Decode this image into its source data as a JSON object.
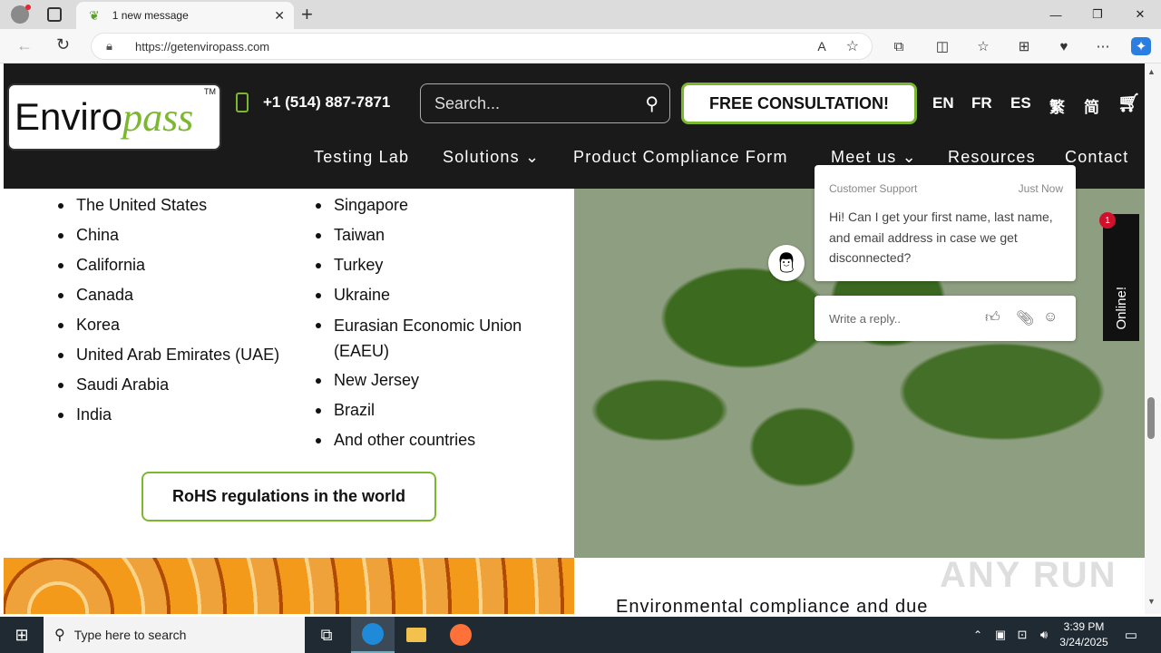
{
  "browser": {
    "tab_title": "1 new message",
    "tab_close": "✕",
    "new_tab": "+",
    "url": "https://getenviropass.com",
    "win_min": "—",
    "win_restore": "❐",
    "win_close": "✕"
  },
  "site": {
    "logo_part1": "Enviro",
    "logo_part2": "pass",
    "logo_tm": "TM",
    "phone": "+1 (514) 887-7871",
    "search_placeholder": "Search...",
    "consult_label": "FREE CONSULTATION!",
    "languages": [
      "EN",
      "FR",
      "ES",
      "繁",
      "简"
    ],
    "nav": [
      "Testing Lab",
      "Solutions ⌄",
      "Product Compliance Form",
      "Meet us ⌄",
      "Resources",
      "Contact"
    ]
  },
  "content": {
    "list_left": [
      "The United States",
      "China",
      "California",
      "Canada",
      "Korea",
      "United Arab Emirates (UAE)",
      "Saudi Arabia",
      "India"
    ],
    "list_right": [
      "Singapore",
      "Taiwan",
      "Turkey",
      "Ukraine",
      "Eurasian Economic Union (EAEU)",
      "New Jersey",
      "Brazil",
      "And other countries"
    ],
    "rohs_button": "RoHS regulations in the world",
    "bottom_heading": "Environmental compliance and due"
  },
  "chat": {
    "agent": "Customer Support",
    "time": "Just Now",
    "message": "Hi! Can I get your first name, last name, and email address in case we get disconnected?",
    "reply_placeholder": "Write a reply..",
    "online_label": "Online!",
    "badge_count": "1"
  },
  "watermark": "ANY RUN",
  "taskbar": {
    "search_placeholder": "Type here to search",
    "time": "3:39 PM",
    "date": "3/24/2025"
  }
}
